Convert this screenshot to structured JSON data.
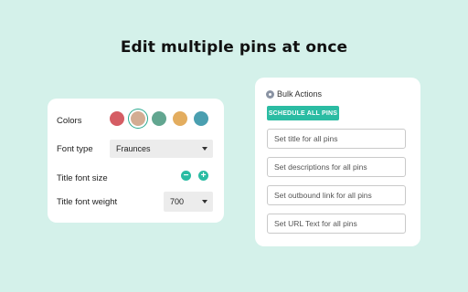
{
  "headline": "Edit multiple pins at once",
  "style_card": {
    "colors_label": "Colors",
    "swatches": [
      {
        "name": "red",
        "color": "#d55d64",
        "selected": false
      },
      {
        "name": "beige",
        "color": "#d3ac93",
        "selected": true
      },
      {
        "name": "green",
        "color": "#62a690",
        "selected": false
      },
      {
        "name": "mustard",
        "color": "#e3ad5f",
        "selected": false
      },
      {
        "name": "teal",
        "color": "#4a9fb0",
        "selected": false
      }
    ],
    "font_type_label": "Font type",
    "font_type_value": "Fraunces",
    "title_font_size_label": "Title font size",
    "decrease_symbol": "−",
    "increase_symbol": "+",
    "title_font_weight_label": "Title font weight",
    "title_font_weight_value": "700"
  },
  "bulk_card": {
    "title": "Bulk Actions",
    "schedule_button": "SCHEDULE ALL PINS",
    "fields": [
      {
        "placeholder": "Set title for all pins"
      },
      {
        "placeholder": "Set descriptions for all pins"
      },
      {
        "placeholder": "Set outbound link for all pins"
      },
      {
        "placeholder": "Set URL Text for all pins"
      }
    ]
  },
  "colors": {
    "background": "#d4f1ea",
    "accent": "#2bbca3"
  }
}
